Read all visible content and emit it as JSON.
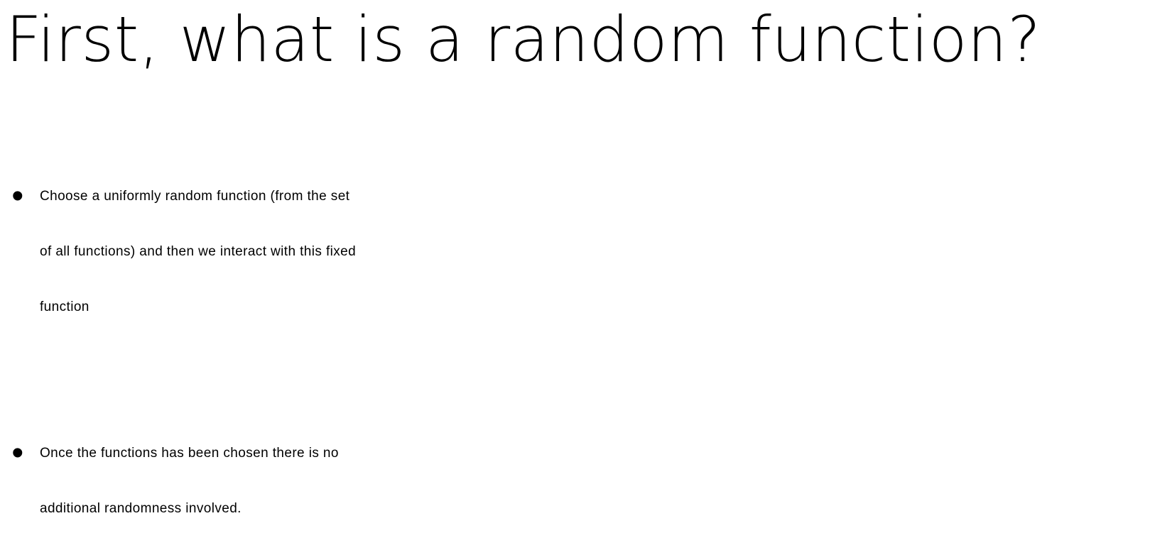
{
  "slide": {
    "title": "First, what is a random function?",
    "bullet_symbol": "•",
    "bullets": [
      {
        "lines": [
          "Choose a uniformly random function (from the set",
          "of all functions) and then we interact with this fixed",
          "function"
        ]
      },
      {
        "lines": [
          "Once the functions has been chosen there is no",
          "additional randomness involved."
        ]
      }
    ]
  }
}
